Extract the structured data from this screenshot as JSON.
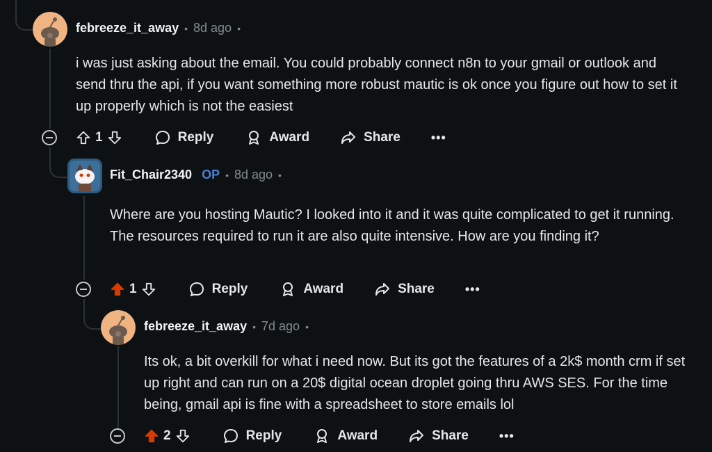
{
  "comments": [
    {
      "username": "febreeze_it_away",
      "op_badge": "",
      "time": "8d ago",
      "body": "i was just asking about the email. You could probably connect n8n to your gmail or outlook and send thru the api, if you want something more robust mautic is ok once you figure out how to set it up properly which is not the easiest",
      "score": "1",
      "upvoted": false
    },
    {
      "username": "Fit_Chair2340",
      "op_badge": "OP",
      "time": "8d ago",
      "body": "Where are you hosting Mautic? I looked into it and it was quite complicated to get it running. The resources required to run it are also quite intensive. How are you finding it?",
      "score": "1",
      "upvoted": true
    },
    {
      "username": "febreeze_it_away",
      "op_badge": "",
      "time": "7d ago",
      "body": "Its ok, a bit overkill for what i need now. But its got the features of a 2k$ month crm if set up right and can run on a 20$ digital ocean droplet going thru AWS SES. For the time being, gmail api is fine with a spreadsheet to store emails lol",
      "score": "2",
      "upvoted": true
    }
  ],
  "labels": {
    "reply": "Reply",
    "award": "Award",
    "share": "Share",
    "more": "•••"
  },
  "colors": {
    "background": "#0e1113",
    "upvote_active": "#d93a00",
    "op_badge": "#4c7fd6",
    "text": "#e4e8ea",
    "muted": "#828b8f"
  }
}
